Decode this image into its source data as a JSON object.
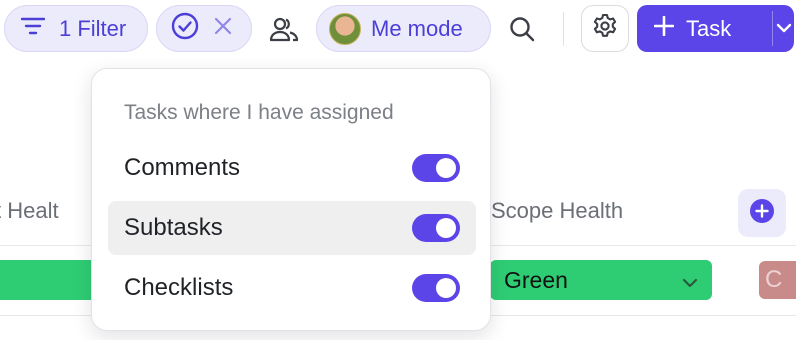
{
  "toolbar": {
    "filter_label": "1 Filter",
    "me_mode_label": "Me mode",
    "task_label": "Task"
  },
  "popover": {
    "heading": "Tasks where I have assigned",
    "options": [
      {
        "label": "Comments",
        "enabled": true
      },
      {
        "label": "Subtasks",
        "enabled": true
      },
      {
        "label": "Checklists",
        "enabled": true
      }
    ]
  },
  "table": {
    "columns": [
      "ct Healt",
      "Scope Health"
    ],
    "row": {
      "scope_health": "Green",
      "next_cell": "C"
    }
  },
  "colors": {
    "accent": "#5b45e8",
    "chip_bg": "#ecebfb",
    "status_green": "#2fcd73"
  },
  "icons": [
    "filter-icon",
    "check-circle-icon",
    "close-icon",
    "people-icon",
    "search-icon",
    "gear-icon",
    "plus-icon",
    "chevron-down-icon",
    "plus-circle-icon"
  ]
}
